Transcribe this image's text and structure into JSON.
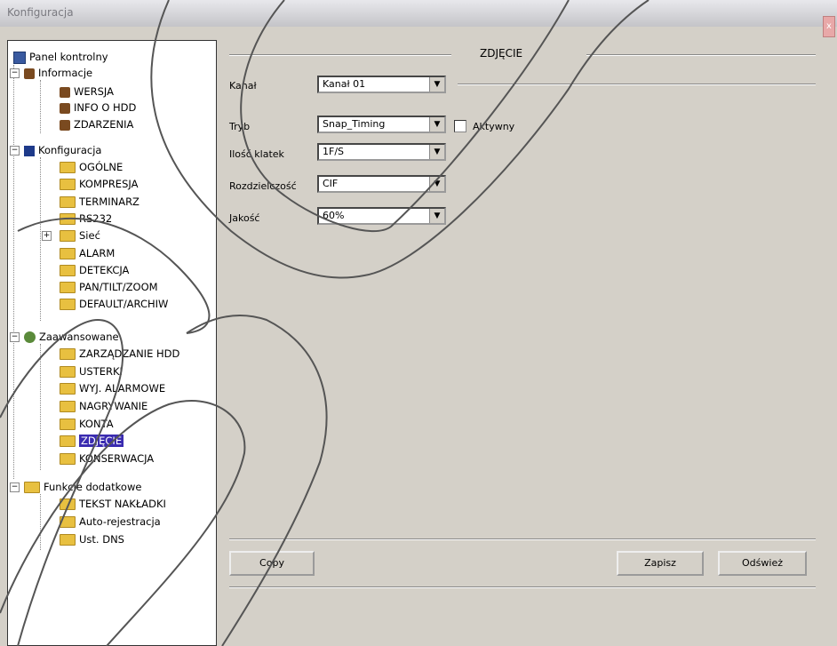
{
  "window": {
    "title": "Konfiguracja",
    "close_glyph": "x"
  },
  "tree": {
    "root": "Panel kontrolny",
    "informacje": "Informacje",
    "wersja": "WERSJA",
    "info_hdd": "INFO O HDD",
    "zdarzenia": "ZDARZENIA",
    "konfiguracja": "Konfiguracja",
    "ogolne": "OGÓLNE",
    "kompresja": "KOMPRESJA",
    "terminarz": "TERMINARZ",
    "rs232": "RS232",
    "siec": "Sieć",
    "alarm": "ALARM",
    "detekcja": "DETEKCJA",
    "ptz": "PAN/TILT/ZOOM",
    "default": "DEFAULT/ARCHIW",
    "zaawansowane": "Zaawansowane",
    "zarzadzanie_hdd": "ZARZĄDZANIE HDD",
    "usterki": "USTERKI",
    "wyj_alarmowe": "WYJ. ALARMOWE",
    "nagrywanie": "NAGRYWANIE",
    "konta": "KONTA",
    "zdjecie": "ZDJĘCIE",
    "konserwacja": "KONSERWACJA",
    "funkcje": "Funkcje dodatkowe",
    "tekst": "TEKST NAKŁADKI",
    "auto": "Auto-rejestracja",
    "dns": "Ust. DNS"
  },
  "panel": {
    "title": "ZDJĘCIE",
    "kanal_label": "Kanał",
    "kanal_value": "Kanał 01",
    "tryb_label": "Tryb",
    "tryb_value": "Snap_Timing",
    "aktywny_label": "Aktywny",
    "ilosc_label": "Ilość klatek",
    "ilosc_value": "1F/S",
    "rozdz_label": "Rozdzielczość",
    "rozdz_value": "CIF",
    "jakosc_label": "Jakość",
    "jakosc_value": "60%"
  },
  "buttons": {
    "copy": "Copy",
    "save": "Zapisz",
    "refresh": "Odśwież"
  }
}
